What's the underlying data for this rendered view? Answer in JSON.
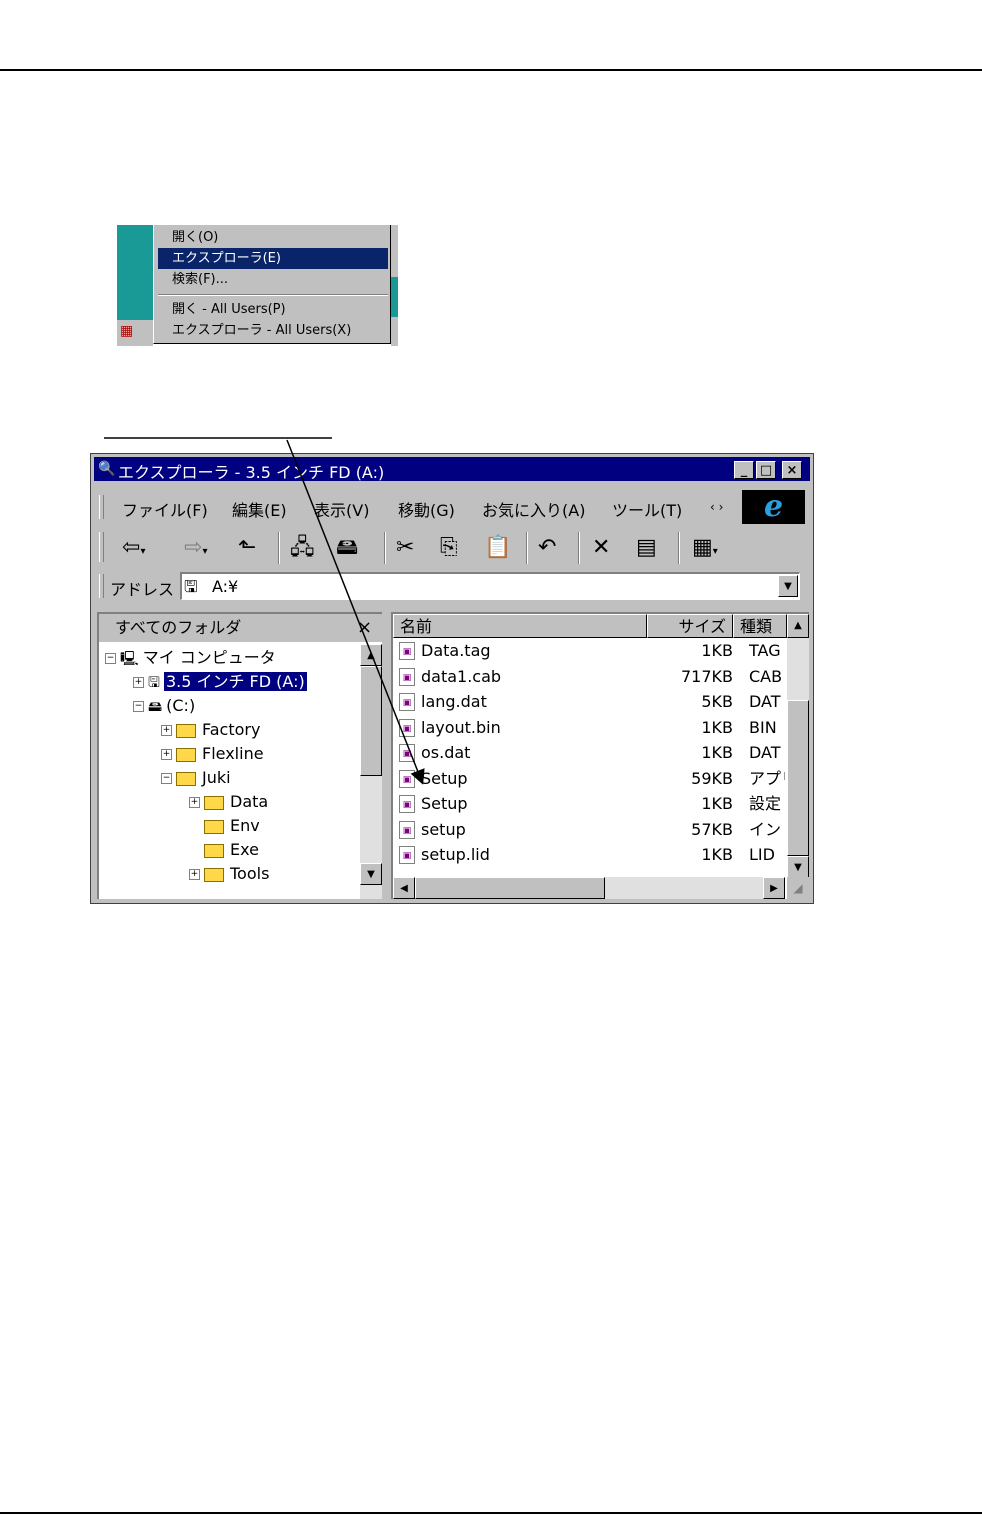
{
  "context_menu": {
    "items": [
      {
        "label": "開く(O)",
        "selected": false
      },
      {
        "label": "エクスプローラ(E)",
        "selected": true
      },
      {
        "label": "検索(F)...",
        "selected": false
      },
      {
        "label": "開く - All Users(P)",
        "selected": false
      },
      {
        "label": "エクスプローラ - All Users(X)",
        "selected": false
      }
    ]
  },
  "window": {
    "title": "エクスプローラ - 3.5 インチ FD (A:)",
    "title_buttons": {
      "minimize": "_",
      "maximize": "□",
      "close": "×"
    },
    "menu": [
      "ファイル(F)",
      "編集(E)",
      "表示(V)",
      "移動(G)",
      "お気に入り(A)",
      "ツール(T)",
      "‹ ›"
    ],
    "address_label": "アドレス",
    "address_value": "A:¥",
    "left_pane": {
      "header": "すべてのフォルダ",
      "close": "×",
      "tree": [
        {
          "label": "マイ コンピュータ",
          "level": 0,
          "expander": "−",
          "icon": "computer-icon"
        },
        {
          "label": "3.5 インチ FD (A:)",
          "level": 1,
          "expander": "+",
          "icon": "floppy-icon",
          "selected": true
        },
        {
          "label": "(C:)",
          "level": 1,
          "expander": "−",
          "icon": "drive-icon"
        },
        {
          "label": "Factory",
          "level": 2,
          "expander": "+",
          "icon": "folder-icon"
        },
        {
          "label": "Flexline",
          "level": 2,
          "expander": "+",
          "icon": "folder-icon"
        },
        {
          "label": "Juki",
          "level": 2,
          "expander": "−",
          "icon": "folder-icon"
        },
        {
          "label": "Data",
          "level": 3,
          "expander": "+",
          "icon": "folder-icon"
        },
        {
          "label": "Env",
          "level": 3,
          "expander": "",
          "icon": "folder-icon"
        },
        {
          "label": "Exe",
          "level": 3,
          "expander": "",
          "icon": "folder-icon"
        },
        {
          "label": "Tools",
          "level": 3,
          "expander": "+",
          "icon": "folder-icon"
        }
      ]
    },
    "right_pane": {
      "columns": [
        "名前",
        "サイズ",
        "種類"
      ],
      "files": [
        {
          "name": "Data.tag",
          "size": "1KB",
          "type": "TAG"
        },
        {
          "name": "data1.cab",
          "size": "717KB",
          "type": "CAB"
        },
        {
          "name": "lang.dat",
          "size": "5KB",
          "type": "DAT"
        },
        {
          "name": "layout.bin",
          "size": "1KB",
          "type": "BIN"
        },
        {
          "name": "os.dat",
          "size": "1KB",
          "type": "DAT"
        },
        {
          "name": "Setup",
          "size": "59KB",
          "type": "アプリ"
        },
        {
          "name": "Setup",
          "size": "1KB",
          "type": "設定"
        },
        {
          "name": "setup",
          "size": "57KB",
          "type": "イン"
        },
        {
          "name": "setup.lid",
          "size": "1KB",
          "type": "LID"
        }
      ]
    }
  }
}
